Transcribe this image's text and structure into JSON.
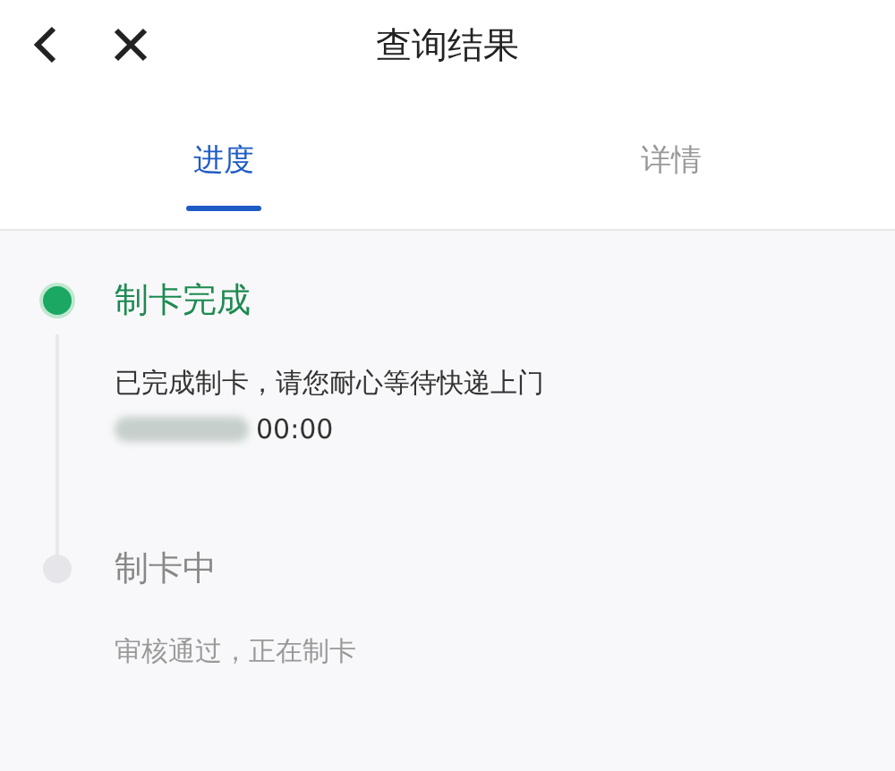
{
  "header": {
    "title": "查询结果"
  },
  "tabs": [
    {
      "label": "进度",
      "selected": true
    },
    {
      "label": "详情",
      "selected": false
    }
  ],
  "timeline": [
    {
      "title": "制卡完成",
      "done": true,
      "description": "已完成制卡，请您耐心等待快递上门",
      "time": "00:00",
      "time_blurred": true
    },
    {
      "title": "制卡中",
      "done": false,
      "description": "审核通过，正在制卡"
    }
  ]
}
